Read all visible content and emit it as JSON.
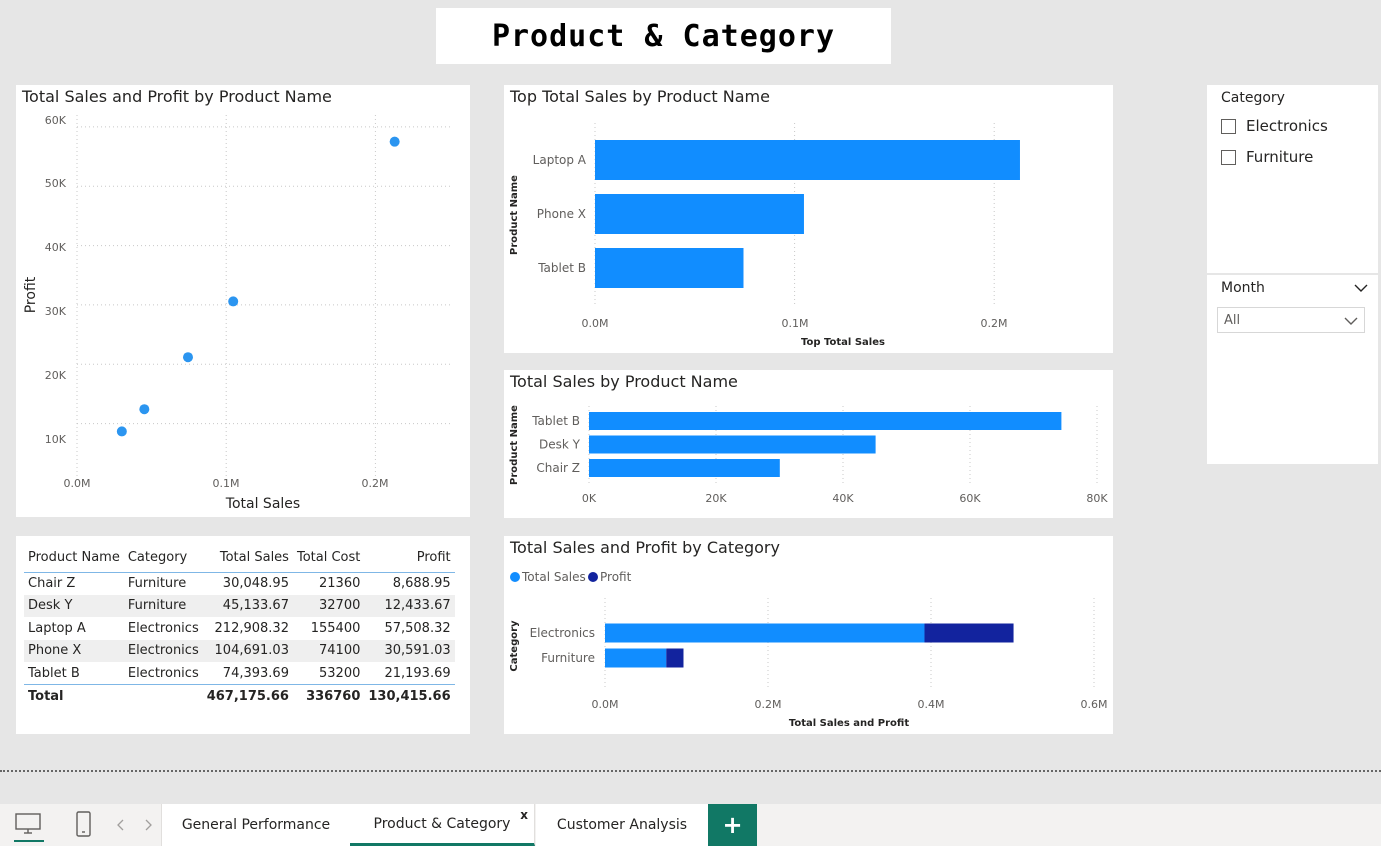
{
  "page_title": "Product & Category",
  "scatter": {
    "title": "Total Sales and Profit by Product Name",
    "xlabel": "Total Sales",
    "ylabel": "Profit",
    "x_ticks": [
      "0.0M",
      "0.1M",
      "0.2M"
    ],
    "y_ticks": [
      "10K",
      "20K",
      "30K",
      "40K",
      "50K",
      "60K"
    ],
    "point_color": "#2b95f0"
  },
  "top_bar": {
    "title": "Top Total Sales by Product Name",
    "xlabel": "Top Total Sales",
    "ylabel": "Product Name",
    "x_ticks": [
      "0.0M",
      "0.1M",
      "0.2M"
    ]
  },
  "sales_bar": {
    "title": "Total Sales by Product Name",
    "ylabel": "Product Name",
    "x_ticks": [
      "0K",
      "20K",
      "40K",
      "60K",
      "80K"
    ]
  },
  "stacked": {
    "title": "Total Sales and Profit by Category",
    "xlabel": "Total Sales and Profit",
    "ylabel": "Category",
    "legend": [
      "Total Sales",
      "Profit"
    ],
    "x_ticks": [
      "0.0M",
      "0.2M",
      "0.4M",
      "0.6M"
    ]
  },
  "table": {
    "headers": [
      "Product Name",
      "Category",
      "Total Sales",
      "Total Cost",
      "Profit"
    ],
    "rows": [
      [
        "Chair Z",
        "Furniture",
        "30,048.95",
        "21360",
        "8,688.95"
      ],
      [
        "Desk Y",
        "Furniture",
        "45,133.67",
        "32700",
        "12,433.67"
      ],
      [
        "Laptop A",
        "Electronics",
        "212,908.32",
        "155400",
        "57,508.32"
      ],
      [
        "Phone X",
        "Electronics",
        "104,691.03",
        "74100",
        "30,591.03"
      ],
      [
        "Tablet B",
        "Electronics",
        "74,393.69",
        "53200",
        "21,193.69"
      ]
    ],
    "total": [
      "Total",
      "",
      "467,175.66",
      "336760",
      "130,415.66"
    ]
  },
  "slicer_category": {
    "title": "Category",
    "options": [
      "Electronics",
      "Furniture"
    ]
  },
  "slicer_month": {
    "title": "Month",
    "selected": "All"
  },
  "tabs": [
    "General Performance",
    "Product & Category",
    "Customer Analysis"
  ],
  "active_tab": "Product & Category",
  "close_label": "x",
  "add_label": "+",
  "colors": {
    "bar": "#118dff",
    "profit": "#12239e",
    "accent": "#117865"
  },
  "chart_data": [
    {
      "type": "scatter",
      "title": "Total Sales and Profit by Product Name",
      "xlabel": "Total Sales",
      "ylabel": "Profit",
      "xlim": [
        0,
        250000
      ],
      "ylim": [
        0,
        62000
      ],
      "points": [
        {
          "name": "Chair Z",
          "x": 30048.95,
          "y": 8688.95
        },
        {
          "name": "Desk Y",
          "x": 45133.67,
          "y": 12433.67
        },
        {
          "name": "Laptop A",
          "x": 212908.32,
          "y": 57508.32
        },
        {
          "name": "Phone X",
          "x": 104691.03,
          "y": 30591.03
        },
        {
          "name": "Tablet B",
          "x": 74393.69,
          "y": 21193.69
        }
      ]
    },
    {
      "type": "bar",
      "title": "Top Total Sales by Product Name",
      "categories": [
        "Laptop A",
        "Phone X",
        "Tablet B"
      ],
      "values": [
        212908.32,
        104691.03,
        74393.69
      ],
      "xlabel": "Top Total Sales",
      "ylabel": "Product Name",
      "xlim": [
        0,
        250000
      ]
    },
    {
      "type": "bar",
      "title": "Total Sales by Product Name",
      "categories": [
        "Tablet B",
        "Desk Y",
        "Chair Z"
      ],
      "values": [
        74393.69,
        45133.67,
        30048.95
      ],
      "ylabel": "Product Name",
      "xlim": [
        0,
        80000
      ]
    },
    {
      "type": "bar",
      "title": "Total Sales and Profit by Category",
      "categories": [
        "Electronics",
        "Furniture"
      ],
      "series": [
        {
          "name": "Total Sales",
          "values": [
            391993.04,
            75182.62
          ]
        },
        {
          "name": "Profit",
          "values": [
            109293.04,
            21122.62
          ]
        }
      ],
      "xlabel": "Total Sales and Profit",
      "ylabel": "Category",
      "xlim": [
        0,
        600000
      ],
      "legend": "top-left"
    }
  ]
}
